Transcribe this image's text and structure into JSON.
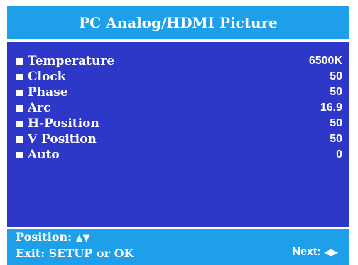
{
  "title": "PC Analog/HDMI Picture",
  "items": [
    {
      "label": "Temperature",
      "value": "6500K"
    },
    {
      "label": "Clock",
      "value": "50"
    },
    {
      "label": "Phase",
      "value": "50"
    },
    {
      "label": "Arc",
      "value": "16.9"
    },
    {
      "label": "H-Position",
      "value": "50"
    },
    {
      "label": "V Position",
      "value": "50"
    },
    {
      "label": "Auto",
      "value": "0"
    }
  ],
  "footer": {
    "position_label": "Position:",
    "position_arrows": "▲▼",
    "exit_label": "Exit: SETUP or OK",
    "next_label": "Next:",
    "next_arrows": "◀▶"
  },
  "colors": {
    "header_bar": "#1e9fe9",
    "panel": "#2d37c8",
    "text": "#ffffff"
  },
  "icons": {
    "bullet": "square-bullet-icon",
    "position_arrows": "up-down-arrows-icon",
    "next_arrows": "left-right-arrows-icon"
  }
}
